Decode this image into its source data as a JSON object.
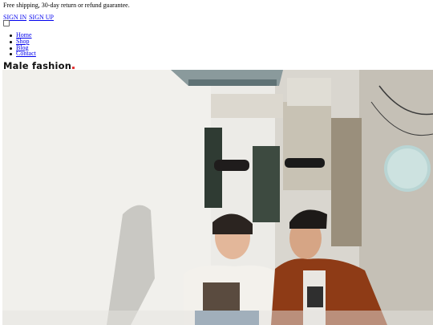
{
  "header": {
    "announcement": "Free shipping, 30-day return or refund guarantee.",
    "auth": {
      "sign_in": "SIGN IN",
      "sign_up": "SIGN UP"
    }
  },
  "nav": {
    "items": [
      "Home",
      "Shop",
      "Blog",
      "Contact"
    ]
  },
  "logo": {
    "text": "Male fashion",
    "accent_color": "#e53637"
  },
  "hero": {
    "image": "hero-photo"
  },
  "colors": {
    "link": "#0000ee",
    "text": "#000000",
    "accent": "#e53637"
  }
}
